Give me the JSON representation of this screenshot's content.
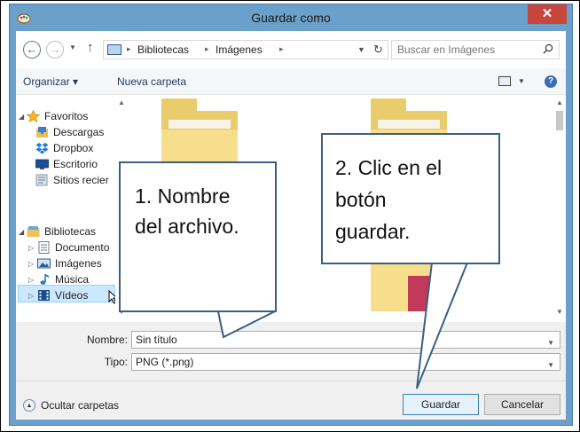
{
  "window": {
    "title": "Guardar como",
    "close_glyph": "✕",
    "title_bar_color": "#6aa0c9"
  },
  "address": {
    "path": [
      "Bibliotecas",
      "Imágenes"
    ],
    "back_glyph": "←",
    "forward_glyph": "→",
    "up_glyph": "↑",
    "search_placeholder": "Buscar en Imágenes"
  },
  "toolbar": {
    "organize_label": "Organizar ▾",
    "new_folder_label": "Nueva carpeta",
    "help_glyph": "?"
  },
  "sidebar": {
    "favorites_label": "Favoritos",
    "favorites": [
      {
        "label": "Descargas",
        "icon": "downloads-icon"
      },
      {
        "label": "Dropbox",
        "icon": "dropbox-icon"
      },
      {
        "label": "Escritorio",
        "icon": "desktop-icon"
      },
      {
        "label": "Sitios recier",
        "icon": "recent-places-icon"
      }
    ],
    "libraries_label": "Bibliotecas",
    "libraries": [
      {
        "label": "Documento",
        "icon": "documents-icon"
      },
      {
        "label": "Imágenes",
        "icon": "pictures-icon",
        "selected": true
      },
      {
        "label": "Música",
        "icon": "music-icon"
      },
      {
        "label": "Vídeos",
        "icon": "videos-icon"
      }
    ]
  },
  "form": {
    "name_label": "Nombre:",
    "name_value": "Sin título",
    "type_label": "Tipo:",
    "type_value": "PNG (*.png)"
  },
  "footer": {
    "hide_folders_label": "Ocultar carpetas",
    "save_label": "Guardar",
    "cancel_label": "Cancelar"
  },
  "callouts": {
    "step1_line1": "1. Nombre",
    "step1_line2": "del archivo.",
    "step2_line1": "2. Clic en el",
    "step2_line2": "botón",
    "step2_line3": "guardar.",
    "border_color": "#3b5f83"
  },
  "colors": {
    "selection": "#cce8ff",
    "folder": "#f7de8c",
    "close_button": "#c7453b"
  }
}
